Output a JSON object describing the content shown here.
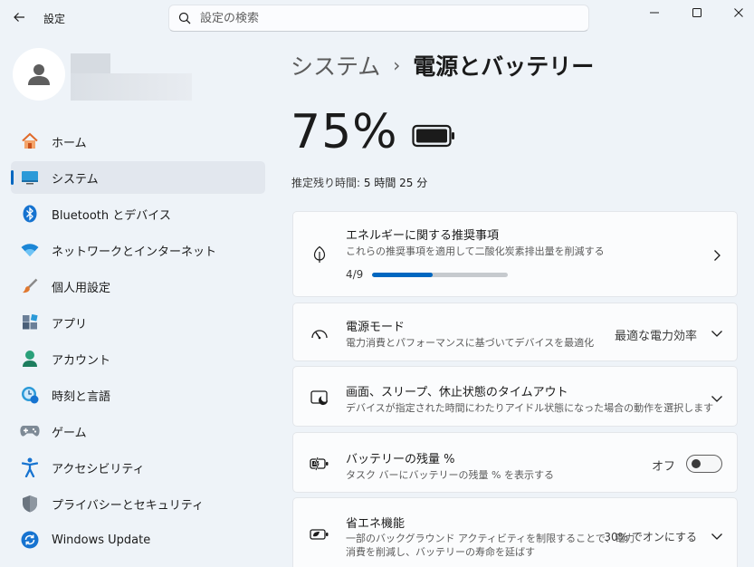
{
  "window": {
    "app_title": "設定"
  },
  "search": {
    "placeholder": "設定の検索"
  },
  "sidebar": {
    "items": [
      {
        "label": "ホーム",
        "icon": "home-icon"
      },
      {
        "label": "システム",
        "icon": "system-icon",
        "active": true
      },
      {
        "label": "Bluetooth とデバイス",
        "icon": "bluetooth-icon"
      },
      {
        "label": "ネットワークとインターネット",
        "icon": "wifi-icon"
      },
      {
        "label": "個人用設定",
        "icon": "brush-icon"
      },
      {
        "label": "アプリ",
        "icon": "apps-icon"
      },
      {
        "label": "アカウント",
        "icon": "account-icon"
      },
      {
        "label": "時刻と言語",
        "icon": "time-language-icon"
      },
      {
        "label": "ゲーム",
        "icon": "gamepad-icon"
      },
      {
        "label": "アクセシビリティ",
        "icon": "accessibility-icon"
      },
      {
        "label": "プライバシーとセキュリティ",
        "icon": "shield-icon"
      },
      {
        "label": "Windows Update",
        "icon": "windows-update-icon"
      }
    ]
  },
  "breadcrumb": {
    "parent": "システム",
    "separator": "›",
    "current": "電源とバッテリー"
  },
  "battery": {
    "percent_text": "75%",
    "remaining_label": "推定残り時間:",
    "remaining_value": "5 時間 25 分"
  },
  "cards": {
    "energy": {
      "title": "エネルギーに関する推奨事項",
      "subtitle": "これらの推奨事項を適用して二酸化炭素排出量を削減する",
      "progress_text": "4/9",
      "progress_fraction": 0.444
    },
    "power_mode": {
      "title": "電源モード",
      "subtitle": "電力消費とパフォーマンスに基づいてデバイスを最適化",
      "value": "最適な電力効率"
    },
    "screen_sleep": {
      "title": "画面、スリープ、休止状態のタイムアウト",
      "subtitle": "デバイスが指定された時間にわたりアイドル状態になった場合の動作を選択します"
    },
    "battery_percent": {
      "title": "バッテリーの残量 %",
      "subtitle": "タスク バーにバッテリーの残量 % を表示する",
      "toggle_label": "オフ"
    },
    "energy_saver": {
      "title": "省エネ機能",
      "subtitle_line1": "一部のバックグラウンド アクティビティを制限することで、電力",
      "subtitle_line2": "消費を削減し、バッテリーの寿命を延ばす",
      "value": "30% でオンにする"
    }
  },
  "colors": {
    "accent": "#0067c0",
    "background": "#eef3f8",
    "card": "#fbfcfd"
  }
}
